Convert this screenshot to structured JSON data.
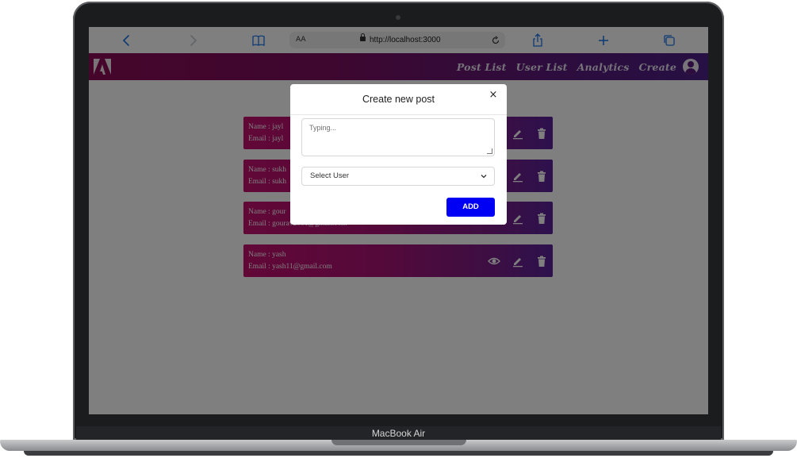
{
  "device": {
    "label": "MacBook Air"
  },
  "browser": {
    "text_size_label": "AA",
    "url": "http://localhost:3000",
    "icons": [
      "back-icon",
      "forward-icon",
      "bookmarks-icon",
      "share-icon",
      "new-tab-icon",
      "tabs-icon",
      "reload-icon",
      "lock-icon"
    ]
  },
  "navbar": {
    "links": [
      "Post List",
      "User List",
      "Analytics",
      "Create"
    ],
    "colors": {
      "start": "#8d0b55",
      "end": "#4e2087"
    }
  },
  "users": [
    {
      "name_line": "Name : jayl",
      "email_line": "Email : jayl",
      "show_view": false
    },
    {
      "name_line": "Name : sukh",
      "email_line": "Email : sukh",
      "show_view": false
    },
    {
      "name_line": "Name : gour",
      "email_line": "Email : gourav2001@gmail.com",
      "show_view": false
    },
    {
      "name_line": "Name : yash",
      "email_line": "Email : yash11@gmail.com",
      "show_view": true
    }
  ],
  "modal": {
    "title": "Create new post",
    "close_symbol": "×",
    "textarea_placeholder": "Typing...",
    "select_value": "Select User",
    "add_label": "ADD",
    "add_color": "#0000f5"
  }
}
